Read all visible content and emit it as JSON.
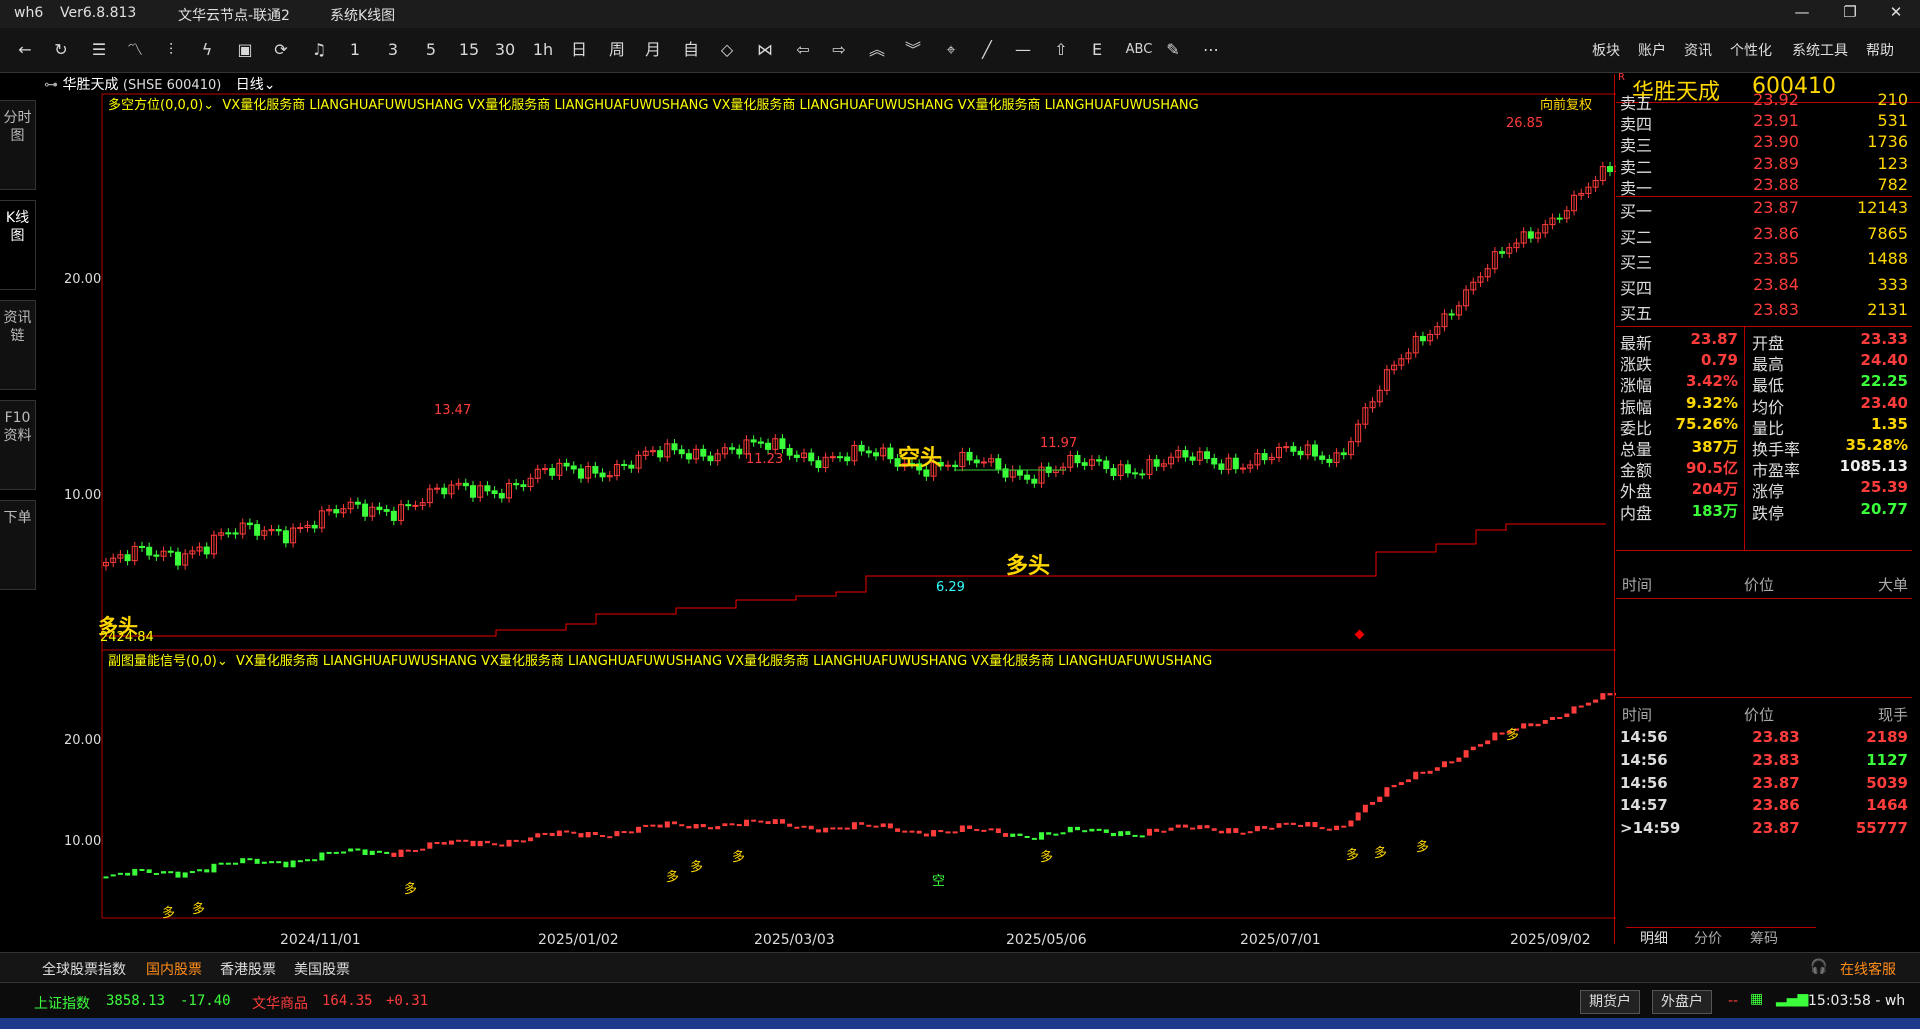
{
  "titlebar": {
    "app": "wh6",
    "version": "Ver6.8.813",
    "server": "文华云节点-联通2",
    "view": "系统K线图",
    "min": "—",
    "restore": "❐",
    "close": "✕"
  },
  "toolbar": {
    "periods": [
      "1",
      "3",
      "5",
      "15",
      "30",
      "1h",
      "日",
      "周",
      "月",
      "自"
    ],
    "menus": [
      "板块",
      "账户",
      "资讯",
      "个性化",
      "系统工具",
      "帮助"
    ]
  },
  "sidetabs": [
    "分时图",
    "K线图",
    "资讯链",
    "F10资料",
    "下单"
  ],
  "chart": {
    "stock_name": "华胜天成",
    "stock_code": "(SHSE 600410)",
    "period": "日线",
    "main_indicator": "多空方位(0,0,0)",
    "main_watermark": "VX量化服务商  LIANGHUAFUWUSHANG  VX量化服务商  LIANGHUAFUWUSHANG  VX量化服务商  LIANGHUAFUWUSHANG  VX量化服务商  LIANGHUAFUWUSHANG",
    "adjust": "向前复权",
    "sub_indicator": "副图量能信号(0,0)",
    "sub_watermark": "VX量化服务商  LIANGHUAFUWUSHANG  VX量化服务商  LIANGHUAFUWUSHANG  VX量化服务商  LIANGHUAFUWUSHANG  VX量化服务商  LIANGHUAFUWUSHANG",
    "main_yticks": [
      "20.00",
      "10.00"
    ],
    "sub_yticks": [
      "20.00",
      "10.00"
    ],
    "dates": [
      "2024/11/01",
      "2025/01/02",
      "2025/03/03",
      "2025/05/06",
      "2025/07/01",
      "2025/09/02"
    ],
    "annotations": {
      "high1": "13.47",
      "high2": "11.23",
      "high3": "11.97",
      "high4": "26.85",
      "low1": "6.29",
      "low0": "2424.84",
      "bear_label": "空头",
      "bull_label": "多头",
      "bull_label_start": "多头"
    },
    "signals": [
      "多",
      "多",
      "多",
      "多",
      "多",
      "多",
      "空",
      "多",
      "多",
      "多",
      "多",
      "多"
    ]
  },
  "chart_data": {
    "type": "line",
    "title": "",
    "x": [
      "2024/11/01",
      "2025/01/02",
      "2025/03/03",
      "2025/05/06",
      "2025/07/01",
      "2025/09/02"
    ],
    "series": [
      {
        "values": [
          6.5,
          8.0,
          9.5,
          8.8,
          9.3,
          24.5
        ]
      }
    ],
    "ylim": [
      5,
      28
    ]
  },
  "panel": {
    "title_name": "华胜天成",
    "title_code": "600410",
    "sell": [
      {
        "label": "卖五",
        "price": "23.92",
        "vol": "210"
      },
      {
        "label": "卖四",
        "price": "23.91",
        "vol": "531"
      },
      {
        "label": "卖三",
        "price": "23.90",
        "vol": "1736"
      },
      {
        "label": "卖二",
        "price": "23.89",
        "vol": "123"
      },
      {
        "label": "卖一",
        "price": "23.88",
        "vol": "782"
      }
    ],
    "buy": [
      {
        "label": "买一",
        "price": "23.87",
        "vol": "12143"
      },
      {
        "label": "买二",
        "price": "23.86",
        "vol": "7865"
      },
      {
        "label": "买三",
        "price": "23.85",
        "vol": "1488"
      },
      {
        "label": "买四",
        "price": "23.84",
        "vol": "333"
      },
      {
        "label": "买五",
        "price": "23.83",
        "vol": "2131"
      }
    ],
    "stats_left": [
      {
        "label": "最新",
        "value": "23.87",
        "color": "red"
      },
      {
        "label": "涨跌",
        "value": "0.79",
        "color": "red"
      },
      {
        "label": "涨幅",
        "value": "3.42%",
        "color": "red"
      },
      {
        "label": "振幅",
        "value": "9.32%",
        "color": "yel"
      },
      {
        "label": "委比",
        "value": "75.26%",
        "color": "yel"
      },
      {
        "label": "总量",
        "value": "387万",
        "color": "yel"
      },
      {
        "label": "金额",
        "value": "90.5亿",
        "color": "red"
      },
      {
        "label": "外盘",
        "value": "204万",
        "color": "red"
      },
      {
        "label": "内盘",
        "value": "183万",
        "color": "grn"
      }
    ],
    "stats_right": [
      {
        "label": "开盘",
        "value": "23.33",
        "color": "red"
      },
      {
        "label": "最高",
        "value": "24.40",
        "color": "red"
      },
      {
        "label": "最低",
        "value": "22.25",
        "color": "grn"
      },
      {
        "label": "均价",
        "value": "23.40",
        "color": "red"
      },
      {
        "label": "量比",
        "value": "1.35",
        "color": "yel"
      },
      {
        "label": "换手率",
        "value": "35.28%",
        "color": "yel"
      },
      {
        "label": "市盈率",
        "value": "1085.13",
        "color": "wht"
      },
      {
        "label": "涨停",
        "value": "25.39",
        "color": "red"
      },
      {
        "label": "跌停",
        "value": "20.77",
        "color": "grn"
      }
    ],
    "big_header": [
      "时间",
      "价位",
      "大单"
    ],
    "tick_header": [
      "时间",
      "价位",
      "现手"
    ],
    "ticks": [
      {
        "time": "14:56",
        "price": "23.83",
        "vol": "2189",
        "vc": "red"
      },
      {
        "time": "14:56",
        "price": "23.83",
        "vol": "1127",
        "vc": "grn"
      },
      {
        "time": "14:56",
        "price": "23.87",
        "vol": "5039",
        "vc": "red"
      },
      {
        "time": "14:57",
        "price": "23.86",
        "vol": "1464",
        "vc": "red"
      },
      {
        "time": ">14:59",
        "price": "23.87",
        "vol": "55777",
        "vc": "red"
      }
    ],
    "tabs": [
      "明细",
      "分价",
      "筹码"
    ]
  },
  "bottom_tabs": [
    "全球股票指数",
    "国内股票",
    "香港股票",
    "美国股票"
  ],
  "service": "在线客服",
  "status": {
    "index1_name": "上证指数",
    "index1_value": "3858.13",
    "index1_change": "-17.40",
    "index2_name": "文华商品",
    "index2_value": "164.35",
    "index2_change": "+0.31",
    "futures_btn": "期货户",
    "foreign_btn": "外盘户",
    "dash": "--",
    "time": "15:03:58 - wh"
  },
  "colors": {
    "up": "#ff3c3c",
    "down": "#3cff3c",
    "accent": "#ffd700"
  }
}
